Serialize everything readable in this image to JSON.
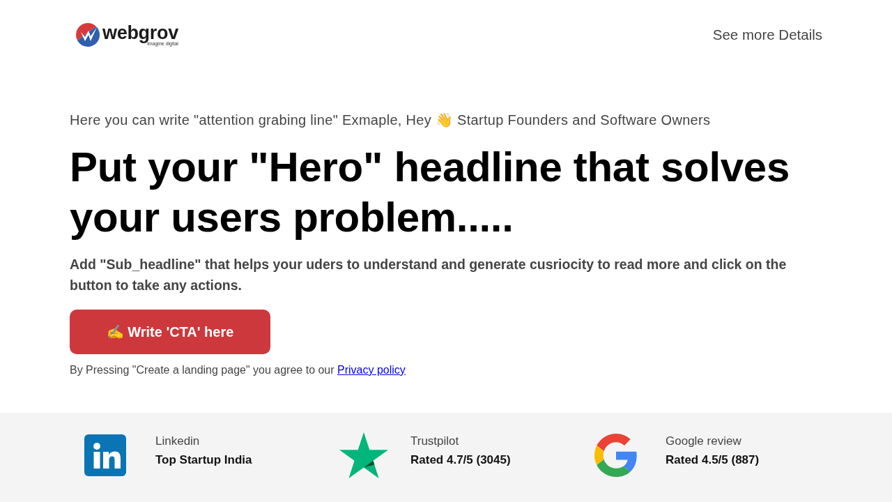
{
  "header": {
    "logo": {
      "name": "webgrov",
      "tagline": "imagine digital"
    },
    "nav_link": "See more Details"
  },
  "hero": {
    "eyebrow": "Here you can write \"attention grabing line\" Exmaple, Hey 👋 Startup Founders and Software Owners",
    "headline": "Put your \"Hero\" headline that solves your users problem.....",
    "subheadline": "Add \"Sub_headline\" that helps your uders to understand and generate cusriocity to read more and click on the button to take any actions.",
    "cta": {
      "label": "✍️ Write 'CTA' here"
    },
    "disclaimer": {
      "text": "By Pressing \"Create a landing page\" you agree to our",
      "link": "Privacy policy"
    }
  },
  "reviews": [
    {
      "kind": "linkedin",
      "source": "Linkedin",
      "rating": "Top Startup India"
    },
    {
      "kind": "trustpilot",
      "source": "Trustpilot",
      "rating": "Rated 4.7/5 (3045)"
    },
    {
      "kind": "google",
      "source": "Google review",
      "rating": "Rated 4.5/5 (887)"
    }
  ]
}
